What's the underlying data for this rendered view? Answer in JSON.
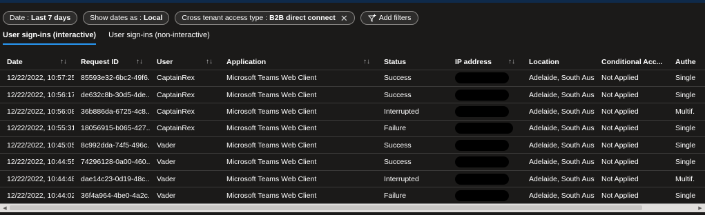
{
  "filters": {
    "date": {
      "prefix": "Date : ",
      "value": "Last 7 days"
    },
    "show_dates": {
      "prefix": "Show dates as : ",
      "value": "Local"
    },
    "cross_tenant": {
      "prefix": "Cross tenant access type : ",
      "value": "B2B direct connect",
      "remove_glyph": "✕"
    },
    "add_filters_label": "Add filters"
  },
  "tabs": [
    {
      "label": "User sign-ins (interactive)",
      "active": true
    },
    {
      "label": "User sign-ins (non-interactive)",
      "active": false
    }
  ],
  "table": {
    "sort_glyph": "↑↓",
    "columns": [
      "Date",
      "Request ID",
      "User",
      "Application",
      "Status",
      "IP address",
      "Location",
      "Conditional Acc...",
      "Authe"
    ],
    "rows": [
      [
        "12/22/2022, 10:57:25...",
        "85593e32-6bc2-49f6...",
        "CaptainRex",
        "Microsoft Teams Web Client",
        "Success",
        "",
        "Adelaide, South Aust...",
        "Not Applied",
        "Single"
      ],
      [
        "12/22/2022, 10:56:17...",
        "de632c8b-30d5-4de...",
        "CaptainRex",
        "Microsoft Teams Web Client",
        "Success",
        "",
        "Adelaide, South Aust...",
        "Not Applied",
        "Single"
      ],
      [
        "12/22/2022, 10:56:08...",
        "36b886da-6725-4c8...",
        "CaptainRex",
        "Microsoft Teams Web Client",
        "Interrupted",
        "",
        "Adelaide, South Aust...",
        "Not Applied",
        "Multif."
      ],
      [
        "12/22/2022, 10:55:31...",
        "18056915-b065-427...",
        "CaptainRex",
        "Microsoft Teams Web Client",
        "Failure",
        "",
        "Adelaide, South Aust...",
        "Not Applied",
        "Single"
      ],
      [
        "12/22/2022, 10:45:05...",
        "8c992dda-74f5-496c...",
        "Vader",
        "Microsoft Teams Web Client",
        "Success",
        "",
        "Adelaide, South Aust...",
        "Not Applied",
        "Single"
      ],
      [
        "12/22/2022, 10:44:55...",
        "74296128-0a00-460...",
        "Vader",
        "Microsoft Teams Web Client",
        "Success",
        "",
        "Adelaide, South Aust...",
        "Not Applied",
        "Single"
      ],
      [
        "12/22/2022, 10:44:48...",
        "dae14c23-0d19-48c...",
        "Vader",
        "Microsoft Teams Web Client",
        "Interrupted",
        "",
        "Adelaide, South Aust...",
        "Not Applied",
        "Multif."
      ],
      [
        "12/22/2022, 10:44:02...",
        "36f4a964-4be0-4a2c...",
        "Vader",
        "Microsoft Teams Web Client",
        "Failure",
        "",
        "Adelaide, South Aust...",
        "Not Applied",
        "Single"
      ]
    ]
  },
  "scrollbar": {
    "left_arrow": "◀",
    "right_arrow": "▶"
  },
  "colors": {
    "background": "#1b1a19",
    "accent": "#2899f5",
    "row_border": "#3b3a39"
  }
}
